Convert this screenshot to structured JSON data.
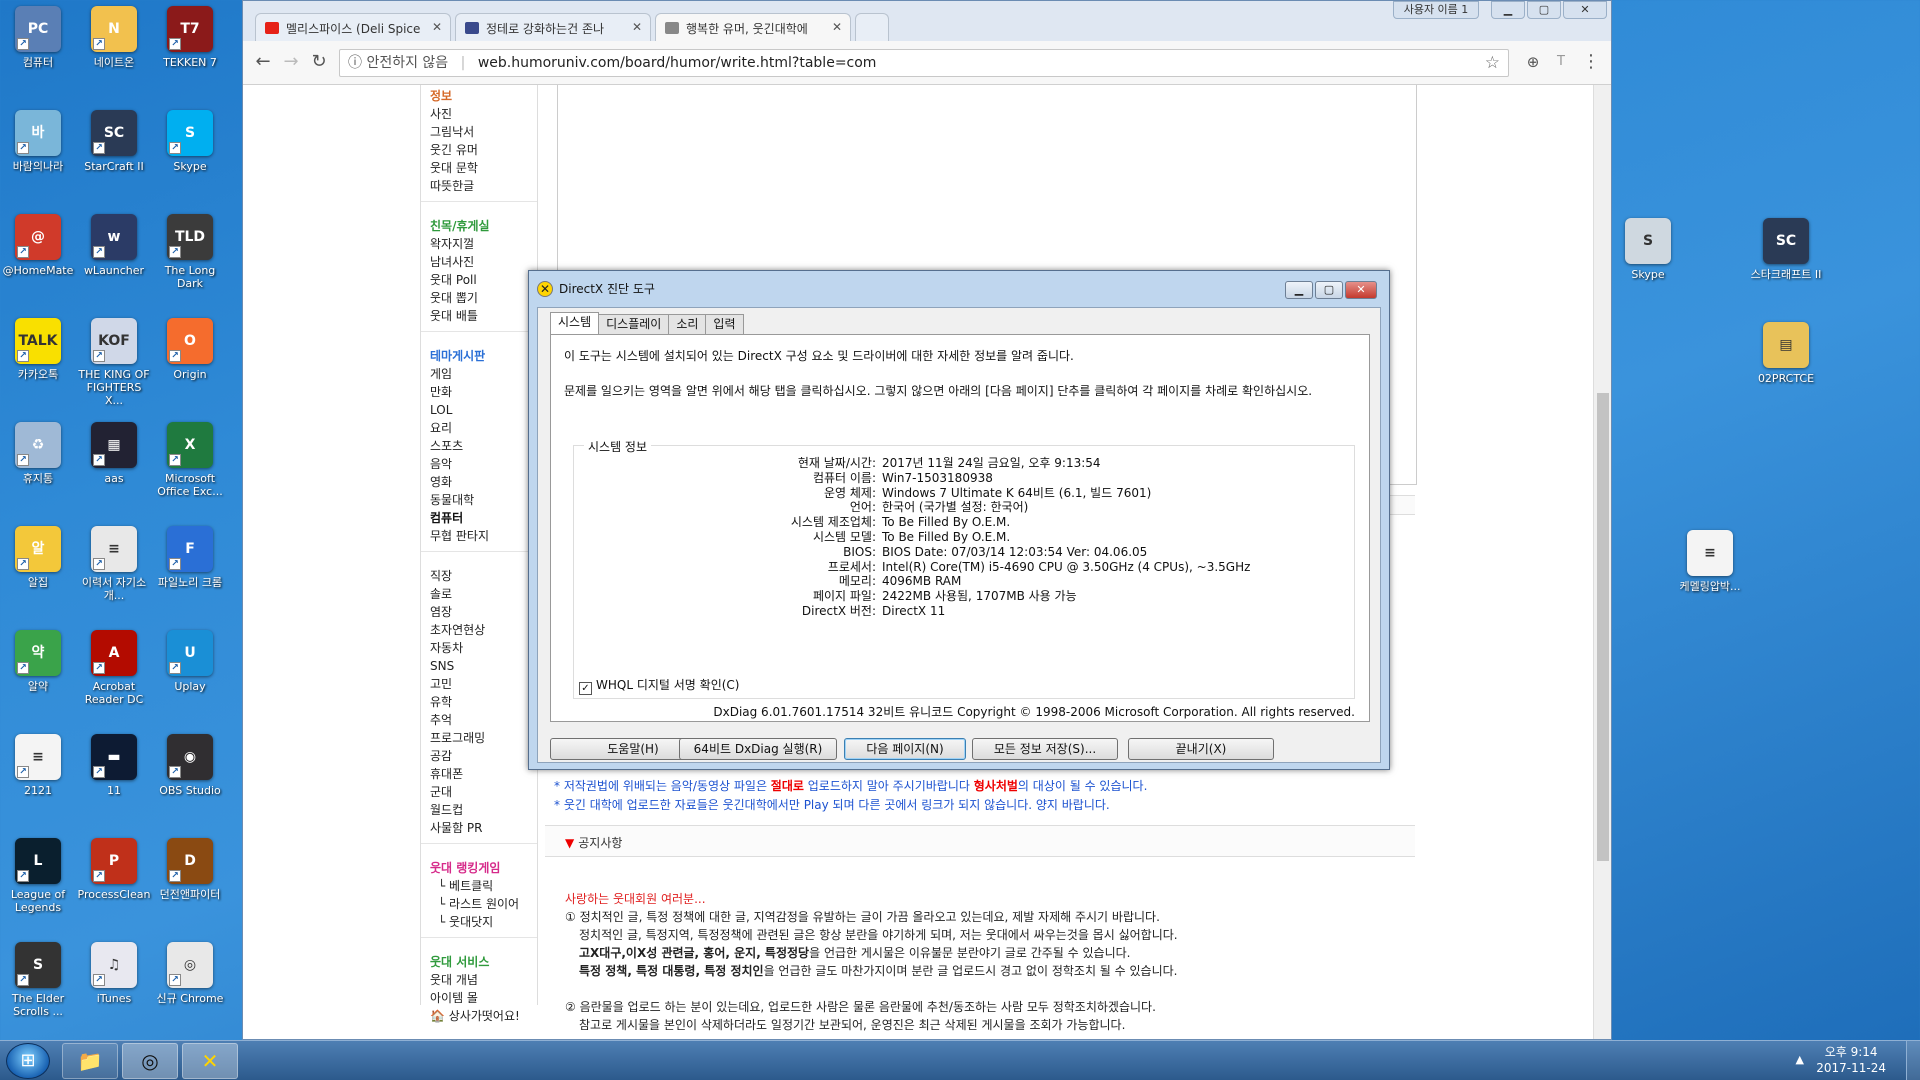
{
  "desktop_left": [
    {
      "label": "컴퓨터",
      "color": "#5a7fb5",
      "glyph": "PC"
    },
    {
      "label": "네이트온",
      "color": "#f2c14e",
      "glyph": "N"
    },
    {
      "label": "TEKKEN 7",
      "color": "#8b1a1a",
      "glyph": "T7"
    },
    {
      "label": "바람의나라",
      "color": "#7ab6d9",
      "glyph": "바"
    },
    {
      "label": "StarCraft II",
      "color": "#2a3a55",
      "glyph": "SC"
    },
    {
      "label": "Skype",
      "color": "#00aff0",
      "glyph": "S"
    },
    {
      "label": "@HomeMate",
      "color": "#d03a2a",
      "glyph": "@"
    },
    {
      "label": "wLauncher",
      "color": "#2b3b66",
      "glyph": "w"
    },
    {
      "label": "The Long Dark",
      "color": "#3b3b3b",
      "glyph": "TLD"
    },
    {
      "label": "카카오톡",
      "color": "#f9e000",
      "glyph": "TALK"
    },
    {
      "label": "THE KING OF FIGHTERS X...",
      "color": "#d0d8e8",
      "glyph": "KOF"
    },
    {
      "label": "Origin",
      "color": "#f56c2d",
      "glyph": "O"
    },
    {
      "label": "휴지통",
      "color": "#9fb9d6",
      "glyph": "♻"
    },
    {
      "label": "aas",
      "color": "#223",
      "glyph": "▦"
    },
    {
      "label": "Microsoft Office Exc...",
      "color": "#1f7a3f",
      "glyph": "X"
    },
    {
      "label": "알집",
      "color": "#f3c83a",
      "glyph": "알"
    },
    {
      "label": "이력서 자기소개...",
      "color": "#e8e8e8",
      "glyph": "≡"
    },
    {
      "label": "파일노리 크롬",
      "color": "#2a6fd6",
      "glyph": "F"
    },
    {
      "label": "알약",
      "color": "#3aa34a",
      "glyph": "약"
    },
    {
      "label": "Acrobat Reader DC",
      "color": "#b30b00",
      "glyph": "A"
    },
    {
      "label": "Uplay",
      "color": "#1a8fd6",
      "glyph": "U"
    },
    {
      "label": "2121",
      "color": "#f4f4f4",
      "glyph": "≡"
    },
    {
      "label": "11",
      "color": "#0d1b33",
      "glyph": "▬"
    },
    {
      "label": "OBS Studio",
      "color": "#302e31",
      "glyph": "◉"
    },
    {
      "label": "League of Legends",
      "color": "#0a1f2e",
      "glyph": "L"
    },
    {
      "label": "ProcessClean",
      "color": "#c0301a",
      "glyph": "P"
    },
    {
      "label": "던전앤파이터",
      "color": "#8a4a12",
      "glyph": "D"
    },
    {
      "label": "The Elder Scrolls ...",
      "color": "#333",
      "glyph": "S"
    },
    {
      "label": "iTunes",
      "color": "#e8e8f0",
      "glyph": "♫"
    },
    {
      "label": "신규 Chrome",
      "color": "#e8e8e8",
      "glyph": "◎"
    }
  ],
  "desktop_right": [
    {
      "label": "Skype",
      "color": "#cfd8e0",
      "glyph": "S"
    },
    {
      "label": "스타크래프트 II",
      "color": "#2a3a55",
      "glyph": "SC"
    },
    {
      "label": "02PRCTCE",
      "color": "#e8c25a",
      "glyph": "▤"
    },
    {
      "label": "케멜링압박...",
      "color": "#f4f4f4",
      "glyph": "≡"
    }
  ],
  "browser": {
    "user_button": "사용자 이름 1",
    "tabs": [
      {
        "title": "멜리스파이스 (Deli Spice",
        "color": "#e62117"
      },
      {
        "title": "정테로 강화하는건 존나",
        "color": "#3a4a8c"
      },
      {
        "title": "행복한 유머, 웃긴대학에",
        "color": "#888888"
      }
    ],
    "security": "안전하지 않음",
    "url": "web.humoruniv.com/board/humor/write.html?table=com"
  },
  "sidenav": [
    {
      "t": "정보",
      "c": "head0"
    },
    {
      "t": "사진",
      "c": "item"
    },
    {
      "t": "그림낙서",
      "c": "item"
    },
    {
      "t": "웃긴 유머",
      "c": "item"
    },
    {
      "t": "웃대 문학",
      "c": "item"
    },
    {
      "t": "따뜻한글",
      "c": "item"
    },
    {
      "t": "",
      "c": "gap"
    },
    {
      "t": "친목/휴게실",
      "c": "head"
    },
    {
      "t": "왁자지껄",
      "c": "item"
    },
    {
      "t": "남녀사진",
      "c": "item"
    },
    {
      "t": "웃대 Poll",
      "c": "item"
    },
    {
      "t": "웃대 뽑기",
      "c": "item"
    },
    {
      "t": "웃대 배틀",
      "c": "item"
    },
    {
      "t": "",
      "c": "gap"
    },
    {
      "t": "테마게시판",
      "c": "head2"
    },
    {
      "t": "게임",
      "c": "item"
    },
    {
      "t": "만화",
      "c": "item"
    },
    {
      "t": "LOL",
      "c": "item"
    },
    {
      "t": "요리",
      "c": "item"
    },
    {
      "t": "스포츠",
      "c": "item"
    },
    {
      "t": "음악",
      "c": "item"
    },
    {
      "t": "영화",
      "c": "item"
    },
    {
      "t": "동물대학",
      "c": "item"
    },
    {
      "t": "컴퓨터",
      "c": "bold"
    },
    {
      "t": "무협 판타지",
      "c": "item"
    },
    {
      "t": "",
      "c": "gap"
    },
    {
      "t": "직장",
      "c": "item"
    },
    {
      "t": "솔로",
      "c": "item"
    },
    {
      "t": "염장",
      "c": "item"
    },
    {
      "t": "초자연현상",
      "c": "item"
    },
    {
      "t": "자동차",
      "c": "item"
    },
    {
      "t": "SNS",
      "c": "item"
    },
    {
      "t": "고민",
      "c": "item"
    },
    {
      "t": "유학",
      "c": "item"
    },
    {
      "t": "추억",
      "c": "item"
    },
    {
      "t": "프로그래밍",
      "c": "item"
    },
    {
      "t": "공감",
      "c": "item"
    },
    {
      "t": "휴대폰",
      "c": "item"
    },
    {
      "t": "군대",
      "c": "item"
    },
    {
      "t": "월드컵",
      "c": "item"
    },
    {
      "t": "사물함 PR",
      "c": "item"
    },
    {
      "t": "",
      "c": "gap"
    },
    {
      "t": "웃대 랭킹게임",
      "c": "head3"
    },
    {
      "t": "└ 베트클릭",
      "c": "sub"
    },
    {
      "t": "└ 라스트 원이어",
      "c": "sub"
    },
    {
      "t": "└ 웃대닷지",
      "c": "sub"
    },
    {
      "t": "",
      "c": "gap"
    },
    {
      "t": "웃대 서비스",
      "c": "head"
    },
    {
      "t": "웃대 개념",
      "c": "item"
    },
    {
      "t": "아이템 몰",
      "c": "item"
    },
    {
      "t": "🏠 상사가떳어요!",
      "c": "item"
    }
  ],
  "notices": {
    "line1_a": "* 저작권법에 위배되는 음악/동영상 파일은 ",
    "line1_b": "절대로",
    "line1_c": " 업로드하지 말아 주시기바랍니다 ",
    "line1_d": "형사처벌",
    "line1_e": "의 대상이 될 수 있습니다.",
    "line2": "* 웃긴 대학에 업로드한 자료들은 웃긴대학에서만 Play 되며 다른 곳에서 링크가 되지 않습니다. 양지 바랍니다.",
    "gongji": "공지사항"
  },
  "rules": {
    "title": "사랑하는 웃대회원 여러분...",
    "l1": "① 정치적인 글, 특정 정책에 대한 글, 지역감정을 유발하는 글이 가끔 올라오고 있는데요, 제발 자제해 주시기 바랍니다.",
    "l2": "정치적인 글, 특정지역, 특정정책에 관련된 글은 항상 분란을 야기하게 되며, 저는 웃대에서 싸우는것을 몹시 싫어합니다.",
    "l3a": "고X대구,이X성 관련글, 홍어, 운지, 특정정당",
    "l3b": "을 언급한 게시물은 이유불문 분란야기 글로 간주될 수 있습니다.",
    "l4a": "특정 정책, 특정 대통령, 특정 정치인",
    "l4b": "을 언급한 글도 마찬가지이며 분란 글 업로드시 경고 없이 정학조치 될 수 있습니다.",
    "l5": "② 음란물을 업로드 하는 분이 있는데요, 업로드한 사람은 물론 음란물에 추천/동조하는 사람 모두 정학조치하겠습니다.",
    "l6": "참고로 게시물을 본인이 삭제하더라도 일정기간 보관되어, 운영진은 최근 삭제된 게시물을 조회가 가능합니다."
  },
  "dxdiag": {
    "title": "DirectX 진단 도구",
    "tabs": [
      "시스템",
      "디스플레이",
      "소리",
      "입력"
    ],
    "intro1": "이 도구는 시스템에 설치되어 있는 DirectX 구성 요소 및 드라이버에 대한 자세한 정보를 알려 줍니다.",
    "intro2": "문제를 일으키는 영역을 알면 위에서 해당 탭을 클릭하십시오. 그렇지 않으면 아래의 [다음 페이지] 단추를 클릭하여 각 페이지를 차례로 확인하십시오.",
    "group_label": "시스템 정보",
    "rows": [
      {
        "k": "현재 날짜/시간:",
        "v": "2017년 11월 24일 금요일, 오후 9:13:54"
      },
      {
        "k": "컴퓨터 이름:",
        "v": "Win7-1503180938"
      },
      {
        "k": "운영 체제:",
        "v": "Windows 7 Ultimate K 64비트 (6.1, 빌드 7601)"
      },
      {
        "k": "언어:",
        "v": "한국어 (국가별 설정: 한국어)"
      },
      {
        "k": "시스템 제조업체:",
        "v": "To Be Filled By O.E.M."
      },
      {
        "k": "시스템 모델:",
        "v": "To Be Filled By O.E.M."
      },
      {
        "k": "BIOS:",
        "v": "BIOS Date: 07/03/14 12:03:54 Ver: 04.06.05"
      },
      {
        "k": "프로세서:",
        "v": "Intel(R) Core(TM) i5-4690 CPU @ 3.50GHz (4 CPUs), ~3.5GHz"
      },
      {
        "k": "메모리:",
        "v": "4096MB RAM"
      },
      {
        "k": "페이지 파일:",
        "v": "2422MB 사용됨, 1707MB 사용 가능"
      },
      {
        "k": "DirectX 버전:",
        "v": "DirectX 11"
      }
    ],
    "whql": "WHQL 디지털 서명 확인(C)",
    "copyright": "DxDiag 6.01.7601.17514 32비트 유니코드  Copyright © 1998-2006 Microsoft Corporation.  All rights reserved.",
    "buttons": [
      "도움말(H)",
      "64비트 DxDiag 실행(R)",
      "다음 페이지(N)",
      "모든 정보 저장(S)...",
      "끝내기(X)"
    ]
  },
  "taskbar": {
    "time": "오후 9:14",
    "date": "2017-11-24"
  }
}
